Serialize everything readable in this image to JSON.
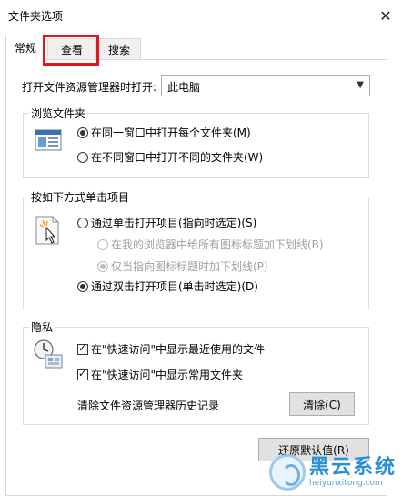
{
  "window": {
    "title": "文件夹选项",
    "close_glyph": "✕"
  },
  "tabs": [
    {
      "label": "常规",
      "active": true
    },
    {
      "label": "查看",
      "active": false,
      "highlighted": true
    },
    {
      "label": "搜索",
      "active": false
    }
  ],
  "open_explorer": {
    "label": "打开文件资源管理器时打开:",
    "selected": "此电脑"
  },
  "browse_folders": {
    "legend": "浏览文件夹",
    "icon": "folder-windows-icon",
    "options": [
      {
        "label": "在同一窗口中打开每个文件夹(M)",
        "checked": true
      },
      {
        "label": "在不同窗口中打开不同的文件夹(W)",
        "checked": false
      }
    ]
  },
  "click_items": {
    "legend": "按如下方式单击项目",
    "icon": "cursor-click-icon",
    "options": [
      {
        "label": "通过单击打开项目(指向时选定)(S)",
        "checked": false,
        "disabled": false
      },
      {
        "label": "在我的浏览器中给所有图标标题加下划线(B)",
        "checked": false,
        "disabled": true
      },
      {
        "label": "仅当指向图标标题时加下划线(P)",
        "checked": true,
        "disabled": true
      },
      {
        "label": "通过双击打开项目(单击时选定)(D)",
        "checked": true,
        "disabled": false
      }
    ]
  },
  "privacy": {
    "legend": "隐私",
    "icon": "privacy-clock-icon",
    "checks": [
      {
        "label": "在\"快速访问\"中显示最近使用的文件",
        "checked": true
      },
      {
        "label": "在\"快速访问\"中显示常用文件夹",
        "checked": true
      }
    ],
    "clear_label": "清除文件资源管理器历史记录",
    "clear_button": "清除(C)"
  },
  "restore_button": "还原默认值(R)",
  "watermark": {
    "name": "黑云系统",
    "url": "heiyunxitong.com"
  },
  "colors": {
    "highlight": "#e0161b",
    "accent": "#2c8fd6"
  }
}
